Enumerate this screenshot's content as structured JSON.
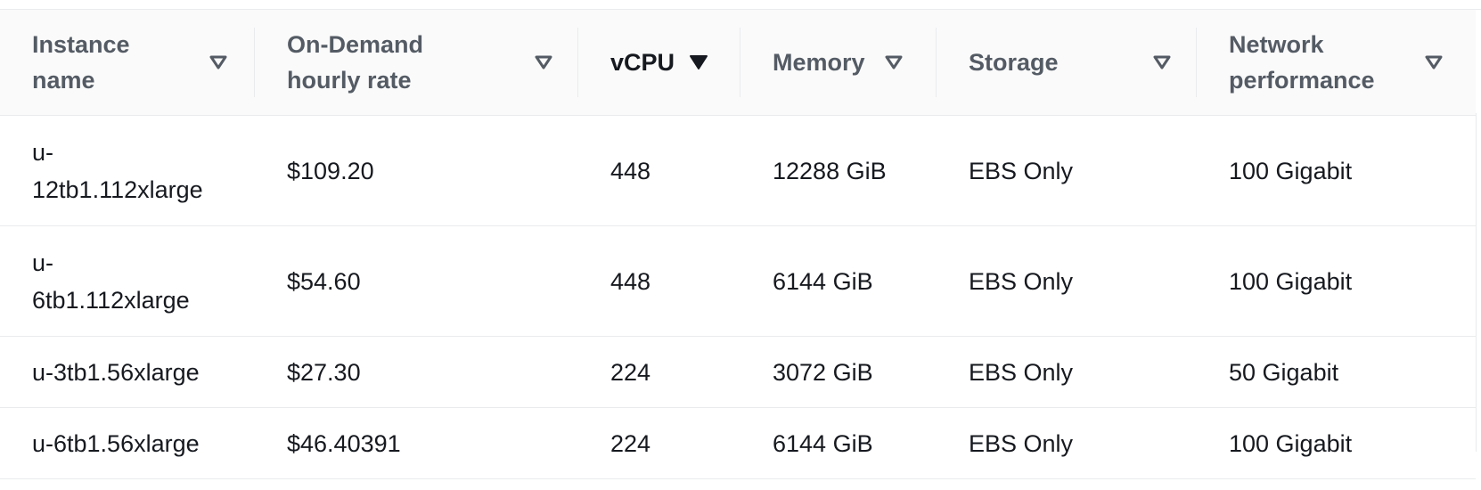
{
  "table": {
    "columns": [
      {
        "label": "Instance\nname",
        "sorted": false
      },
      {
        "label": "On-Demand\nhourly rate",
        "sorted": false
      },
      {
        "label": "vCPU",
        "sorted": true
      },
      {
        "label": "Memory",
        "sorted": false
      },
      {
        "label": "Storage",
        "sorted": false
      },
      {
        "label": "Network\nperformance",
        "sorted": false
      }
    ],
    "rows": [
      {
        "instance": "u-\n12tb1.112xlarge",
        "rate": "$109.20",
        "vcpu": "448",
        "memory": "12288 GiB",
        "storage": "EBS Only",
        "network": "100 Gigabit"
      },
      {
        "instance": "u-\n6tb1.112xlarge",
        "rate": "$54.60",
        "vcpu": "448",
        "memory": "6144 GiB",
        "storage": "EBS Only",
        "network": "100 Gigabit"
      },
      {
        "instance": "u-3tb1.56xlarge",
        "rate": "$27.30",
        "vcpu": "224",
        "memory": "3072 GiB",
        "storage": "EBS Only",
        "network": "50 Gigabit"
      },
      {
        "instance": "u-6tb1.56xlarge",
        "rate": "$46.40391",
        "vcpu": "224",
        "memory": "6144 GiB",
        "storage": "EBS Only",
        "network": "100 Gigabit"
      }
    ]
  },
  "icons": {
    "sort_inactive": "caret-down-outline-icon",
    "sort_active": "caret-down-filled-icon"
  },
  "colors": {
    "header_bg": "#fafafa",
    "border": "#e9ebed",
    "header_text": "#545b64",
    "text": "#16191f"
  }
}
